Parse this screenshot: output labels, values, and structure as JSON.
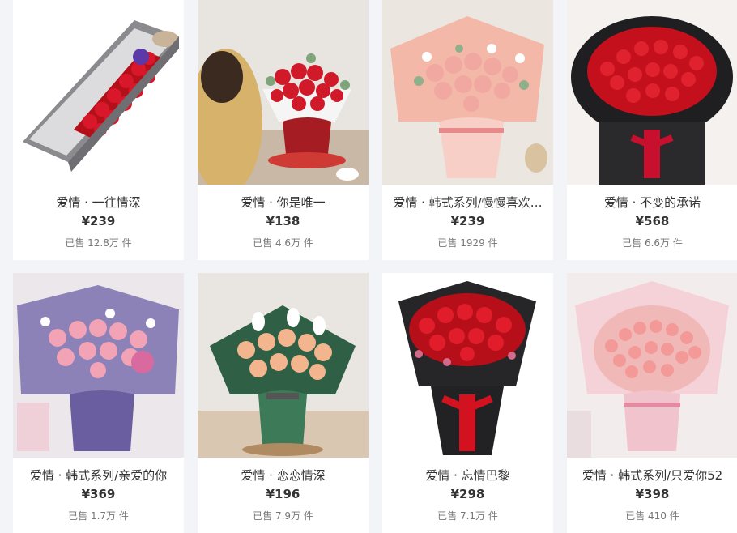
{
  "products": [
    {
      "title": "爱情 · 一往情深",
      "price": "¥239",
      "sales": "已售 12.8万 件"
    },
    {
      "title": "爱情 · 你是唯一",
      "price": "¥138",
      "sales": "已售 4.6万 件"
    },
    {
      "title": "爱情 · 韩式系列/慢慢喜欢…",
      "price": "¥239",
      "sales": "已售 1929 件"
    },
    {
      "title": "爱情 · 不变的承诺",
      "price": "¥568",
      "sales": "已售 6.6万 件"
    },
    {
      "title": "爱情 · 韩式系列/亲爱的你",
      "price": "¥369",
      "sales": "已售 1.7万 件"
    },
    {
      "title": "爱情 · 恋恋情深",
      "price": "¥196",
      "sales": "已售 7.9万 件"
    },
    {
      "title": "爱情 · 忘情巴黎",
      "price": "¥298",
      "sales": "已售 7.1万 件"
    },
    {
      "title": "爱情 · 韩式系列/只爱你52",
      "price": "¥398",
      "sales": "已售 410 件"
    }
  ],
  "colors": {
    "page_bg": "#f3f4f8",
    "card_bg": "#ffffff",
    "title_text": "#333333",
    "sales_text": "#777777",
    "red_rose": "#c8102e",
    "pink_rose": "#f2a7a7"
  }
}
